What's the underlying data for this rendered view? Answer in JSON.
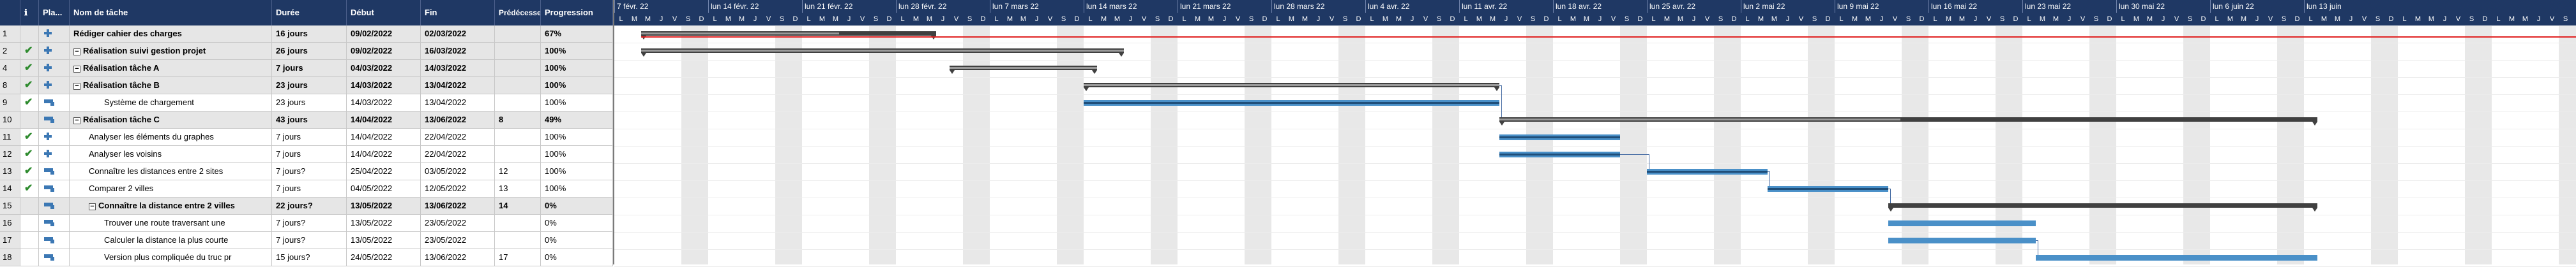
{
  "headers": {
    "info": "ℹ",
    "mode": "Pla...",
    "name": "Nom de tâche",
    "duration": "Durée",
    "start": "Début",
    "end": "Fin",
    "pred": "Prédécesseurs",
    "progress": "Progression"
  },
  "rows": [
    {
      "num": "1",
      "check": "",
      "mode": "pin",
      "name": "Rédiger cahier des charges",
      "duration": "16 jours",
      "start": "09/02/2022",
      "end": "02/03/2022",
      "pred": "",
      "progress": "67%",
      "summary": true,
      "collapse": false,
      "indent": 0
    },
    {
      "num": "2",
      "check": "✔",
      "mode": "pin",
      "name": "Réalisation suivi gestion projet",
      "duration": "26 jours",
      "start": "09/02/2022",
      "end": "16/03/2022",
      "pred": "",
      "progress": "100%",
      "summary": true,
      "collapse": true,
      "indent": 0
    },
    {
      "num": "4",
      "check": "✔",
      "mode": "pin",
      "name": "Réalisation tâche A",
      "duration": "7 jours",
      "start": "04/03/2022",
      "end": "14/03/2022",
      "pred": "",
      "progress": "100%",
      "summary": true,
      "collapse": true,
      "indent": 0
    },
    {
      "num": "8",
      "check": "✔",
      "mode": "pin",
      "name": "Réalisation tâche B",
      "duration": "23 jours",
      "start": "14/03/2022",
      "end": "13/04/2022",
      "pred": "",
      "progress": "100%",
      "summary": true,
      "collapse": true,
      "indent": 0
    },
    {
      "num": "9",
      "check": "✔",
      "mode": "auto",
      "name": "Système de chargement",
      "duration": "23 jours",
      "start": "14/03/2022",
      "end": "13/04/2022",
      "pred": "",
      "progress": "100%",
      "summary": false,
      "collapse": false,
      "indent": 2
    },
    {
      "num": "10",
      "check": "",
      "mode": "auto",
      "name": "Réalisation tâche C",
      "duration": "43 jours",
      "start": "14/04/2022",
      "end": "13/06/2022",
      "pred": "8",
      "progress": "49%",
      "summary": true,
      "collapse": true,
      "indent": 0
    },
    {
      "num": "11",
      "check": "✔",
      "mode": "pin",
      "name": "Analyser les éléments du graphes",
      "duration": "7 jours",
      "start": "14/04/2022",
      "end": "22/04/2022",
      "pred": "",
      "progress": "100%",
      "summary": false,
      "collapse": false,
      "indent": 1
    },
    {
      "num": "12",
      "check": "✔",
      "mode": "pin",
      "name": "Analyser les voisins",
      "duration": "7 jours",
      "start": "14/04/2022",
      "end": "22/04/2022",
      "pred": "",
      "progress": "100%",
      "summary": false,
      "collapse": false,
      "indent": 1
    },
    {
      "num": "13",
      "check": "✔",
      "mode": "auto",
      "name": "Connaître les distances entre 2 sites",
      "duration": "7 jours?",
      "start": "25/04/2022",
      "end": "03/05/2022",
      "pred": "12",
      "progress": "100%",
      "summary": false,
      "collapse": false,
      "indent": 1
    },
    {
      "num": "14",
      "check": "✔",
      "mode": "auto",
      "name": "Comparer 2 villes",
      "duration": "7 jours",
      "start": "04/05/2022",
      "end": "12/05/2022",
      "pred": "13",
      "progress": "100%",
      "summary": false,
      "collapse": false,
      "indent": 1
    },
    {
      "num": "15",
      "check": "",
      "mode": "auto",
      "name": "Connaître la distance entre 2 villes",
      "duration": "22 jours?",
      "start": "13/05/2022",
      "end": "13/06/2022",
      "pred": "14",
      "progress": "0%",
      "summary": true,
      "collapse": true,
      "indent": 1
    },
    {
      "num": "16",
      "check": "",
      "mode": "auto",
      "name": "Trouver une route traversant une",
      "duration": "7 jours?",
      "start": "13/05/2022",
      "end": "23/05/2022",
      "pred": "",
      "progress": "0%",
      "summary": false,
      "collapse": false,
      "indent": 2
    },
    {
      "num": "17",
      "check": "",
      "mode": "auto",
      "name": "Calculer la distance la plus courte",
      "duration": "7 jours?",
      "start": "13/05/2022",
      "end": "23/05/2022",
      "pred": "",
      "progress": "0%",
      "summary": false,
      "collapse": false,
      "indent": 2
    },
    {
      "num": "18",
      "check": "",
      "mode": "auto",
      "name": "Version plus compliquée du truc pr",
      "duration": "15 jours?",
      "start": "24/05/2022",
      "end": "13/06/2022",
      "pred": "17",
      "progress": "0%",
      "summary": false,
      "collapse": false,
      "indent": 2
    }
  ],
  "timescale": {
    "weeks": [
      "7 févr. 22",
      "lun 14 févr. 22",
      "lun 21 févr. 22",
      "lun 28 févr. 22",
      "lun 7 mars 22",
      "lun 14 mars 22",
      "lun 21 mars 22",
      "lun 28 mars 22",
      "lun 4 avr. 22",
      "lun 11 avr. 22",
      "lun 18 avr. 22",
      "lun 25 avr. 22",
      "lun 2 mai 22",
      "lun 9 mai 22",
      "lun 16 mai 22",
      "lun 23 mai 22",
      "lun 30 mai 22",
      "lun 6 juin 22",
      "lun 13 juin"
    ],
    "days": [
      "L",
      "M",
      "M",
      "J",
      "V",
      "S",
      "D"
    ]
  },
  "colors": {
    "header": "#1f3864",
    "task": "#4a90c8",
    "summary": "#404040",
    "deadline": "#e02020",
    "check": "#2e8b2e"
  }
}
